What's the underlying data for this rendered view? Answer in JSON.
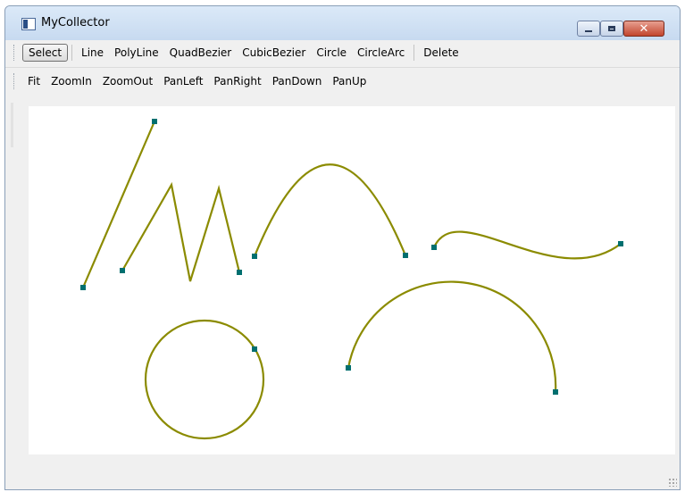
{
  "window": {
    "title": "MyCollector",
    "controls": {
      "minimize": "minimize-icon",
      "maximize": "maximize-icon",
      "close": "close-icon"
    }
  },
  "toolbar_draw": {
    "items": [
      "Select",
      "Line",
      "PolyLine",
      "QuadBezier",
      "CubicBezier",
      "Circle",
      "CircleArc",
      "Delete"
    ],
    "active": "Select"
  },
  "toolbar_view": {
    "items": [
      "Fit",
      "ZoomIn",
      "ZoomOut",
      "PanLeft",
      "PanRight",
      "PanDown",
      "PanUp"
    ]
  },
  "colors": {
    "shape_stroke": "#8b8b00",
    "handle": "#006f6f",
    "canvas": "#ffffff",
    "background": "#f0f0f0"
  }
}
